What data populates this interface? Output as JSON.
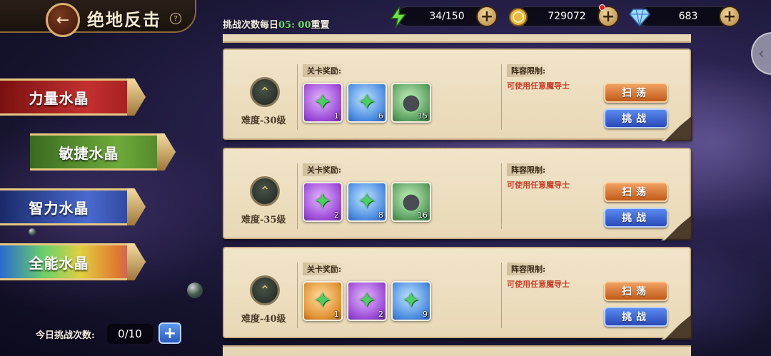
{
  "header": {
    "back_icon": "←",
    "title": "绝地反击",
    "help_icon": "?",
    "reset_prefix": "挑战次数每日",
    "reset_time": "05: 00",
    "reset_suffix": "重置"
  },
  "resources": {
    "stamina": {
      "icon": "lightning-icon",
      "value": "34/150"
    },
    "gold": {
      "icon": "coin-icon",
      "value": "729072"
    },
    "diamond": {
      "icon": "diamond-icon",
      "value": "683"
    }
  },
  "tabs": [
    {
      "label": "力量水晶"
    },
    {
      "label": "敏捷水晶"
    },
    {
      "label": "智力水晶"
    },
    {
      "label": "全能水晶"
    }
  ],
  "daily": {
    "label": "今日挑战次数:",
    "value": "0/10"
  },
  "cards": [
    {
      "level": "难度-30级",
      "reward_label": "关卡奖励:",
      "restrict_label": "阵容限制:",
      "restrict_text": "可使用任意魔导士",
      "sweep": "扫荡",
      "fight": "挑战",
      "items": [
        {
          "type": "crystal",
          "color": "purple",
          "count": "1"
        },
        {
          "type": "crystal",
          "color": "blue",
          "count": "6"
        },
        {
          "type": "ore",
          "color": "green",
          "count": "15"
        }
      ]
    },
    {
      "level": "难度-35级",
      "reward_label": "关卡奖励:",
      "restrict_label": "阵容限制:",
      "restrict_text": "可使用任意魔导士",
      "sweep": "扫荡",
      "fight": "挑战",
      "items": [
        {
          "type": "crystal",
          "color": "purple",
          "count": "2"
        },
        {
          "type": "crystal",
          "color": "blue",
          "count": "8"
        },
        {
          "type": "ore",
          "color": "green",
          "count": "16"
        }
      ]
    },
    {
      "level": "难度-40级",
      "reward_label": "关卡奖励:",
      "restrict_label": "阵容限制:",
      "restrict_text": "可使用任意魔导士",
      "sweep": "扫荡",
      "fight": "挑战",
      "items": [
        {
          "type": "crystal",
          "color": "orange",
          "count": "1"
        },
        {
          "type": "crystal",
          "color": "purple",
          "count": "2"
        },
        {
          "type": "crystal",
          "color": "blue",
          "count": "9"
        }
      ]
    }
  ]
}
